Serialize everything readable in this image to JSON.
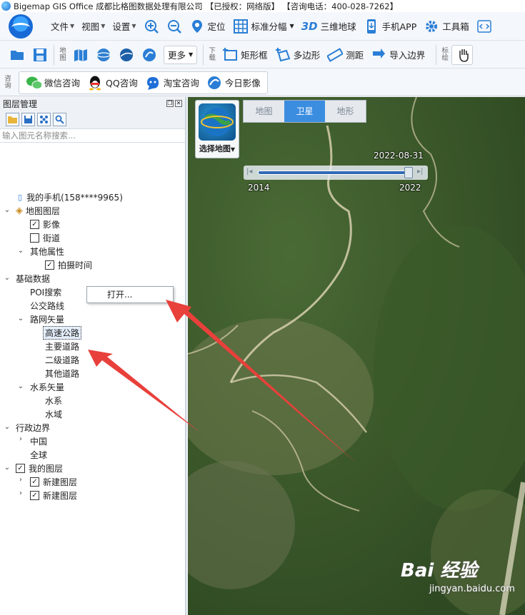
{
  "app": {
    "title": "Bigemap GIS Office 成都比格图数据处理有限公司",
    "license": "【已授权：网络版】",
    "phone": "【咨询电话：400-028-7262】"
  },
  "menu": [
    {
      "label": "文件"
    },
    {
      "label": "视图"
    },
    {
      "label": "设置"
    }
  ],
  "toolbar1": {
    "locate": "定位",
    "grid": "标准分幅",
    "three_d_badge": "3D",
    "three_d": "三维地球",
    "mobile": "手机APP",
    "toolbox": "工具箱"
  },
  "toolbar2": {
    "map_label": "地图",
    "more": "更多",
    "download_label": "下载",
    "rect": "矩形框",
    "polygon": "多边形",
    "measure": "测距",
    "import": "导入边界",
    "mark_label": "标绘"
  },
  "toolbar3": {
    "consult_label": "咨询",
    "wechat": "微信咨询",
    "qq": "QQ咨询",
    "taobao": "淘宝咨询",
    "today": "今日影像"
  },
  "panel": {
    "title": "图层管理",
    "search_placeholder": "输入图元名称搜索...",
    "tree": {
      "phone": "我的手机(158****9965)",
      "map_layers": "地图图层",
      "imagery": "影像",
      "streets": "街道",
      "other_props": "其他属性",
      "shot_time": "拍摄时间",
      "base_data": "基础数据",
      "poi": "POI搜索",
      "bus": "公交路线",
      "road_vector": "路网矢量",
      "highway": "高速公路",
      "main_road": "主要道路",
      "secondary_road": "二级道路",
      "other_road": "其他道路",
      "water_vector": "水系矢量",
      "water_system": "水系",
      "water_area": "水域",
      "admin_border": "行政边界",
      "china": "中国",
      "globe": "全球",
      "my_layers": "我的图层",
      "new_layer_1": "新建图层",
      "new_layer_2": "新建图层"
    }
  },
  "context_menu": {
    "open": "打开..."
  },
  "map": {
    "select_map": "选择地图",
    "tabs": [
      "地图",
      "卫星",
      "地形"
    ],
    "active_tab": "卫星",
    "timeline_date": "2022-08-31",
    "timeline_start": "2014",
    "timeline_end": "2022",
    "watermark_brand": "Bai 经验",
    "watermark_url": "jingyan.baidu.com"
  },
  "colors": {
    "accent": "#3b8de0",
    "arrow": "#e8403a",
    "vegetation": "#3d5a2a"
  }
}
